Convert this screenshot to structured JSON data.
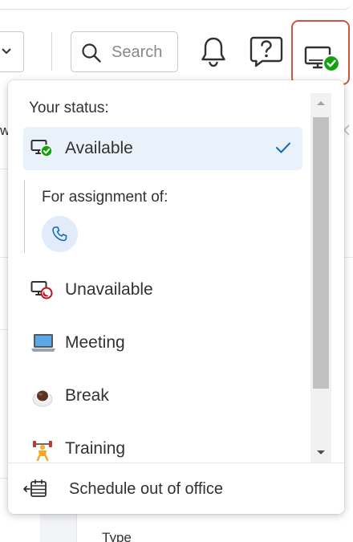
{
  "header": {
    "search": {
      "placeholder": "Search",
      "value": ""
    },
    "icons": [
      "chevron-down-icon",
      "search-icon",
      "bell-icon",
      "help-icon",
      "status-available-icon"
    ]
  },
  "status_menu": {
    "title": "Your status:",
    "items": [
      {
        "label": "Available",
        "icon": "available-icon",
        "selected": true
      },
      {
        "label": "Unavailable",
        "icon": "unavailable-icon",
        "selected": false
      },
      {
        "label": "Meeting",
        "icon": "laptop-icon",
        "selected": false
      },
      {
        "label": "Break",
        "icon": "coffee-icon",
        "selected": false
      },
      {
        "label": "Training",
        "icon": "training-icon",
        "selected": false
      }
    ],
    "assignment_label": "For assignment of:",
    "assignment_icon": "phone-icon",
    "footer_label": "Schedule out of office"
  },
  "background": {
    "type_label": "Type",
    "partial_text": "w"
  },
  "colors": {
    "accent": "#0f6cbd",
    "available_green": "#13a10e",
    "unavailable_red": "#c50f1f",
    "selected_bg": "#e9f1fb",
    "highlight_border": "#d0543f"
  }
}
